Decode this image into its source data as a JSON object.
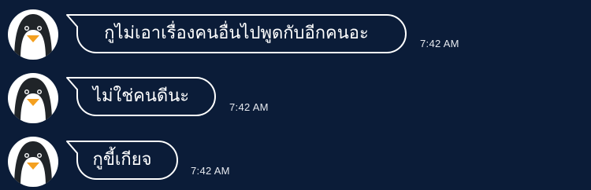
{
  "messages": [
    {
      "text": "กูไม่เอาเรื่องคนอื่นไปพูดกับอีกคนอะ",
      "time": "7:42 AM"
    },
    {
      "text": "ไม่ใช่คนดีนะ",
      "time": "7:42 AM"
    },
    {
      "text": "กูขี้เกียจ",
      "time": "7:42 AM"
    }
  ],
  "avatar_icon": "penguin-icon",
  "colors": {
    "background": "#0b1c38",
    "bubble_border": "#ffffff",
    "text": "#ffffff",
    "avatar_bg": "#ffffff",
    "penguin_body": "#202428",
    "penguin_beak": "#f4a020"
  }
}
